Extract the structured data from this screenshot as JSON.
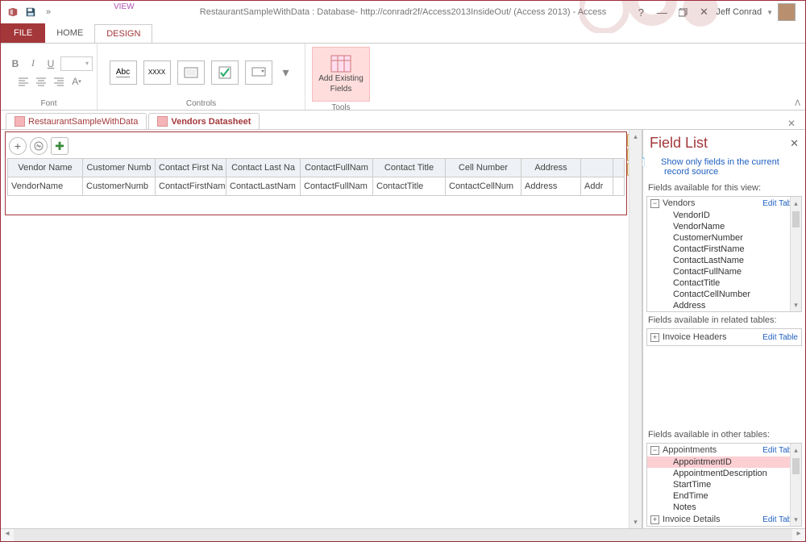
{
  "titlebar": {
    "view_label": "VIEW",
    "title": "RestaurantSampleWithData : Database- http://conradr2f/Access2013InsideOut/ (Access 2013) - Access",
    "user": "Jeff Conrad"
  },
  "tabs": {
    "file": "FILE",
    "home": "HOME",
    "design": "DESIGN"
  },
  "ribbon": {
    "font_group": "Font",
    "controls_group": "Controls",
    "tools_group": "Tools",
    "add_existing_top": "Add Existing",
    "add_existing_bottom": "Fields",
    "abc": "Abc",
    "xxxx": "XXXX"
  },
  "objtabs": {
    "tab1": "RestaurantSampleWithData",
    "tab2": "Vendors Datasheet"
  },
  "grid": {
    "headers": [
      "Vendor Name",
      "Customer Numb",
      "Contact First Na",
      "Contact Last Na",
      "ContactFullNam",
      "Contact Title",
      "Cell Number",
      "Address",
      ""
    ],
    "row": [
      "VendorName",
      "CustomerNumb",
      "ContactFirstNam",
      "ContactLastNam",
      "ContactFullNam",
      "ContactTitle",
      "ContactCellNum",
      "Address",
      "Addr"
    ],
    "widths": [
      93,
      90,
      88,
      92,
      90,
      90,
      94,
      74,
      40
    ]
  },
  "fieldlist": {
    "title": "Field List",
    "show_only": "Show only fields in the current record source",
    "avail_view": "Fields available for this view:",
    "vendors": "Vendors",
    "edit": "Edit Table",
    "vendor_fields": [
      "VendorID",
      "VendorName",
      "CustomerNumber",
      "ContactFirstName",
      "ContactLastName",
      "ContactFullName",
      "ContactTitle",
      "ContactCellNumber",
      "Address"
    ],
    "avail_related": "Fields available in related tables:",
    "related1": "Invoice Headers",
    "avail_other": "Fields available in other tables:",
    "other1": "Appointments",
    "appt_fields": [
      "AppointmentID",
      "AppointmentDescription",
      "StartTime",
      "EndTime",
      "Notes"
    ],
    "other2": "Invoice Details"
  }
}
